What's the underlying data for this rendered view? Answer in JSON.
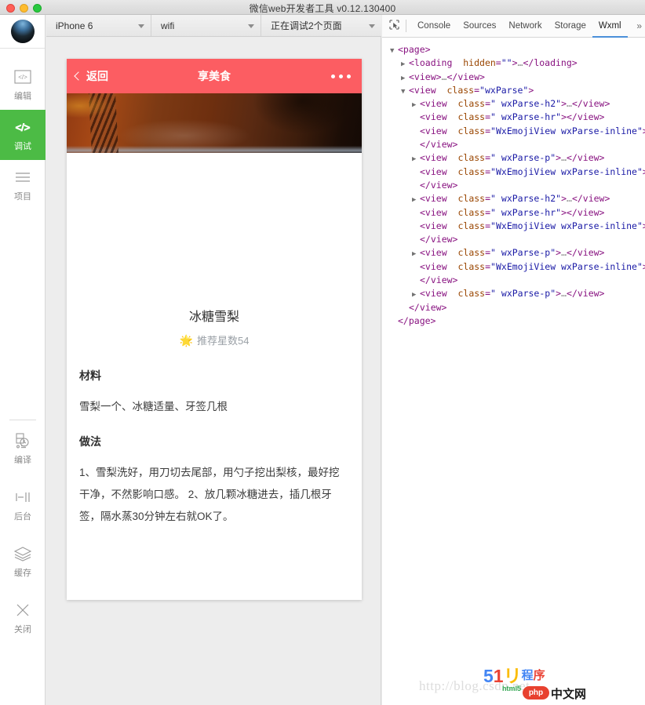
{
  "window": {
    "title": "微信web开发者工具 v0.12.130400",
    "traffic": [
      "close",
      "minimize",
      "maximize"
    ]
  },
  "rail": {
    "top_items": [
      {
        "label": "编辑",
        "icon": "code-icon",
        "active": false
      },
      {
        "label": "调试",
        "icon": "code-icon",
        "active": true
      },
      {
        "label": "项目",
        "icon": "list-icon",
        "active": false
      }
    ],
    "bottom_items": [
      {
        "label": "编译",
        "icon": "refresh-build-icon"
      },
      {
        "label": "后台",
        "icon": "background-icon"
      },
      {
        "label": "缓存",
        "icon": "layers-icon"
      },
      {
        "label": "关闭",
        "icon": "close-icon"
      }
    ]
  },
  "simulator": {
    "device": "iPhone 6",
    "network": "wifi",
    "debug_status": "正在调试2个页面",
    "nav": {
      "back_label": "返回",
      "title": "享美食",
      "more_label": "更多"
    },
    "page": {
      "recipe_title": "冰糖雪梨",
      "star_emoji": "🌟",
      "star_text": "推荐星数54",
      "section_materials_heading": "材料",
      "materials_text": "雪梨一个、冰糖适量、牙签几根",
      "section_steps_heading": "做法",
      "steps_text": "1、雪梨洗好，用刀切去尾部，用勺子挖出梨核，最好挖干净，不然影响口感。\n2、放几颗冰糖进去，插几根牙签，隔水蒸30分钟左右就OK了。"
    }
  },
  "devtools": {
    "inspect_icon": "inspect-element-icon",
    "tabs": [
      {
        "label": "Console",
        "active": false
      },
      {
        "label": "Sources",
        "active": false
      },
      {
        "label": "Network",
        "active": false
      },
      {
        "label": "Storage",
        "active": false
      },
      {
        "label": "Wxml",
        "active": true
      }
    ],
    "overflow_label": "»",
    "tree": [
      {
        "indent": 0,
        "arrow": "▼",
        "html": "<span class=\"tok-tag\">&lt;page&gt;</span>"
      },
      {
        "indent": 1,
        "arrow": "▶",
        "html": "<span class=\"tok-tag\">&lt;loading</span>  <span class=\"tok-attr\">hidden</span><span class=\"tok-tag\">=</span><span class=\"tok-val\">\"\"</span><span class=\"tok-tag\">&gt;</span><span class=\"tok-ell\">…</span><span class=\"tok-tag\">&lt;/loading&gt;</span>"
      },
      {
        "indent": 1,
        "arrow": "▶",
        "html": "<span class=\"tok-tag\">&lt;view&gt;</span><span class=\"tok-ell\">…</span><span class=\"tok-tag\">&lt;/view&gt;</span>"
      },
      {
        "indent": 1,
        "arrow": "▼",
        "html": "<span class=\"tok-tag\">&lt;view</span>  <span class=\"tok-attr\">class</span><span class=\"tok-tag\">=</span><span class=\"tok-val\">\"wxParse\"</span><span class=\"tok-tag\">&gt;</span>"
      },
      {
        "indent": 2,
        "arrow": "▶",
        "html": "<span class=\"tok-tag\">&lt;view</span>  <span class=\"tok-attr\">class</span><span class=\"tok-tag\">=</span><span class=\"tok-val\">\" wxParse-h2\"</span><span class=\"tok-tag\">&gt;</span><span class=\"tok-ell\">…</span><span class=\"tok-tag\">&lt;/view&gt;</span>"
      },
      {
        "indent": 2,
        "arrow": " ",
        "html": "<span class=\"tok-tag\">&lt;view</span>  <span class=\"tok-attr\">class</span><span class=\"tok-tag\">=</span><span class=\"tok-val\">\" wxParse-hr\"</span><span class=\"tok-tag\">&gt;&lt;/view&gt;</span>"
      },
      {
        "indent": 2,
        "arrow": " ",
        "html": "<span class=\"tok-tag\">&lt;view</span>  <span class=\"tok-attr\">class</span><span class=\"tok-tag\">=</span><span class=\"tok-val\">\"WxEmojiView wxParse-inline\"</span><span class=\"tok-tag\">&gt;</span>"
      },
      {
        "indent": 2,
        "arrow": " ",
        "html": "<span class=\"tok-tag\">&lt;/view&gt;</span>"
      },
      {
        "indent": 2,
        "arrow": "▶",
        "html": "<span class=\"tok-tag\">&lt;view</span>  <span class=\"tok-attr\">class</span><span class=\"tok-tag\">=</span><span class=\"tok-val\">\" wxParse-p\"</span><span class=\"tok-tag\">&gt;</span><span class=\"tok-ell\">…</span><span class=\"tok-tag\">&lt;/view&gt;</span>"
      },
      {
        "indent": 2,
        "arrow": " ",
        "html": "<span class=\"tok-tag\">&lt;view</span>  <span class=\"tok-attr\">class</span><span class=\"tok-tag\">=</span><span class=\"tok-val\">\"WxEmojiView wxParse-inline\"</span><span class=\"tok-tag\">&gt;</span>"
      },
      {
        "indent": 2,
        "arrow": " ",
        "html": "<span class=\"tok-tag\">&lt;/view&gt;</span>"
      },
      {
        "indent": 2,
        "arrow": "▶",
        "html": "<span class=\"tok-tag\">&lt;view</span>  <span class=\"tok-attr\">class</span><span class=\"tok-tag\">=</span><span class=\"tok-val\">\" wxParse-h2\"</span><span class=\"tok-tag\">&gt;</span><span class=\"tok-ell\">…</span><span class=\"tok-tag\">&lt;/view&gt;</span>"
      },
      {
        "indent": 2,
        "arrow": " ",
        "html": "<span class=\"tok-tag\">&lt;view</span>  <span class=\"tok-attr\">class</span><span class=\"tok-tag\">=</span><span class=\"tok-val\">\" wxParse-hr\"</span><span class=\"tok-tag\">&gt;&lt;/view&gt;</span>"
      },
      {
        "indent": 2,
        "arrow": " ",
        "html": "<span class=\"tok-tag\">&lt;view</span>  <span class=\"tok-attr\">class</span><span class=\"tok-tag\">=</span><span class=\"tok-val\">\"WxEmojiView wxParse-inline\"</span><span class=\"tok-tag\">&gt;</span>"
      },
      {
        "indent": 2,
        "arrow": " ",
        "html": "<span class=\"tok-tag\">&lt;/view&gt;</span>"
      },
      {
        "indent": 2,
        "arrow": "▶",
        "html": "<span class=\"tok-tag\">&lt;view</span>  <span class=\"tok-attr\">class</span><span class=\"tok-tag\">=</span><span class=\"tok-val\">\" wxParse-p\"</span><span class=\"tok-tag\">&gt;</span><span class=\"tok-ell\">…</span><span class=\"tok-tag\">&lt;/view&gt;</span>"
      },
      {
        "indent": 2,
        "arrow": " ",
        "html": "<span class=\"tok-tag\">&lt;view</span>  <span class=\"tok-attr\">class</span><span class=\"tok-tag\">=</span><span class=\"tok-val\">\"WxEmojiView wxParse-inline\"</span><span class=\"tok-tag\">&gt;</span>"
      },
      {
        "indent": 2,
        "arrow": " ",
        "html": "<span class=\"tok-tag\">&lt;/view&gt;</span>"
      },
      {
        "indent": 2,
        "arrow": "▶",
        "html": "<span class=\"tok-tag\">&lt;view</span>  <span class=\"tok-attr\">class</span><span class=\"tok-tag\">=</span><span class=\"tok-val\">\" wxParse-p\"</span><span class=\"tok-tag\">&gt;</span><span class=\"tok-ell\">…</span><span class=\"tok-tag\">&lt;/view&gt;</span>"
      },
      {
        "indent": 1,
        "arrow": " ",
        "html": "<span class=\"tok-tag\">&lt;/view&gt;</span>"
      },
      {
        "indent": 0,
        "arrow": " ",
        "html": "<span class=\"tok-tag\">&lt;/page&gt;</span>"
      }
    ]
  },
  "watermark": {
    "url": "http://blog.csdn.net",
    "logo_5": "5",
    "logo_1": "1",
    "logo_u": "リ",
    "logo_cn1": "程",
    "logo_cn2": "序",
    "html_text": "html5",
    "php_text": "php",
    "zw_text": "中文网"
  },
  "colors": {
    "accent_green": "#4cbb45",
    "nav_red": "#fc5d62",
    "tab_active_blue": "#4a90d9",
    "star_yellow": "#f5c518"
  }
}
